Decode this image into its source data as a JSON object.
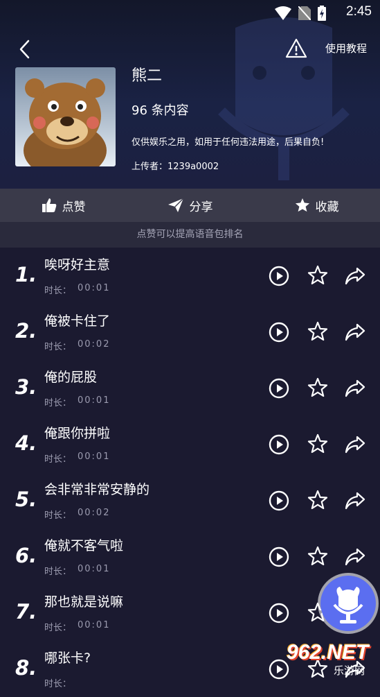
{
  "status": {
    "time": "2:45"
  },
  "header": {
    "tutorial_label": "使用教程"
  },
  "pack": {
    "name": "熊二",
    "count": "96 条内容",
    "disclaimer": "仅供娱乐之用，如用于任何违法用途，后果自负!",
    "uploader": "上传者：1239a0002"
  },
  "actions": {
    "like": "点赞",
    "share": "分享",
    "collect": "收藏"
  },
  "hint": "点赞可以提高语音包排名",
  "duration_label": "时长：",
  "items": [
    {
      "num": "1.",
      "title": "唉呀好主意",
      "duration": "00:01"
    },
    {
      "num": "2.",
      "title": "俺被卡住了",
      "duration": "00:02"
    },
    {
      "num": "3.",
      "title": "俺的屁股",
      "duration": "00:01"
    },
    {
      "num": "4.",
      "title": "俺跟你拼啦",
      "duration": "00:01"
    },
    {
      "num": "5.",
      "title": "会非常非常安静的",
      "duration": "00:02"
    },
    {
      "num": "6.",
      "title": "俺就不客气啦",
      "duration": "00:01"
    },
    {
      "num": "7.",
      "title": "那也就是说嘛",
      "duration": "00:01"
    },
    {
      "num": "8.",
      "title": "哪张卡?",
      "duration": ""
    }
  ],
  "watermark": {
    "main": "962.NET",
    "sub": "乐游网"
  },
  "colors": {
    "fab": "#5b6ef0",
    "action_bar": "#3a3a4a",
    "background": "#1b1a30"
  }
}
